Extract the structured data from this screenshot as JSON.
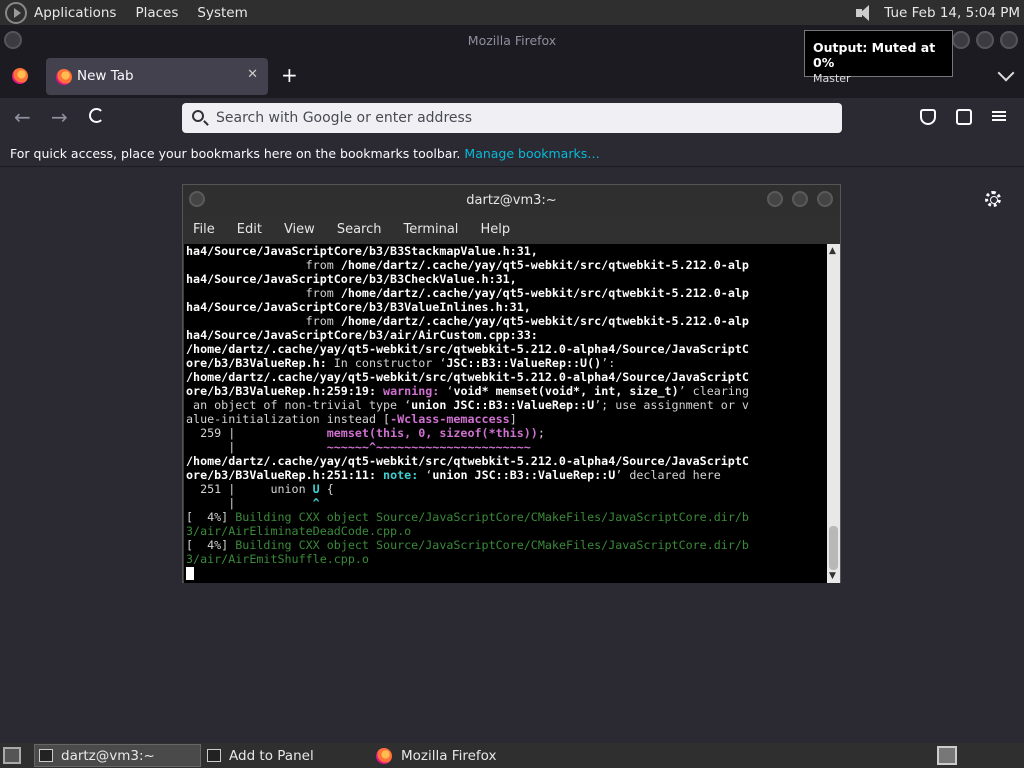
{
  "top_panel": {
    "menus": [
      "Applications",
      "Places",
      "System"
    ],
    "clock": "Tue Feb 14,  5:04 PM"
  },
  "osd": {
    "title": "Output: Muted at 0%",
    "subtitle": "Master"
  },
  "firefox": {
    "window_title": "Mozilla Firefox",
    "tab_label": "New Tab",
    "tab_close": "✕",
    "new_tab": "+",
    "url_placeholder": "Search with Google or enter address",
    "bookmarks_text": "For quick access, place your bookmarks here on the bookmarks toolbar.",
    "bookmarks_link": "Manage bookmarks…"
  },
  "terminal": {
    "title": "dartz@vm3:~",
    "menus": [
      "File",
      "Edit",
      "View",
      "Search",
      "Terminal",
      "Help"
    ]
  },
  "bottom_panel": {
    "tasks": [
      "dartz@vm3:~",
      "Add to Panel",
      "Mozilla Firefox"
    ]
  }
}
